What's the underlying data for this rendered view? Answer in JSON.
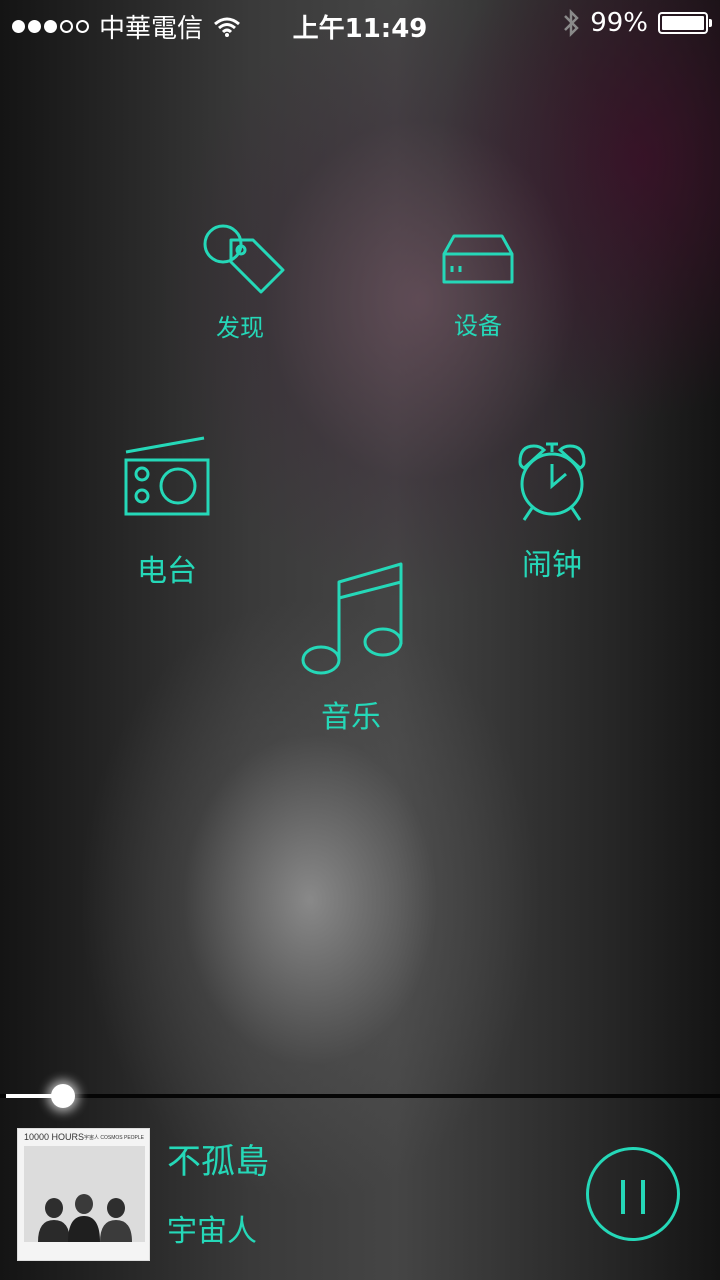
{
  "status_bar": {
    "carrier": "中華電信",
    "time": "上午11:49",
    "battery_percent": "99%",
    "signal_dots_filled": 3,
    "signal_dots_total": 5,
    "icons": [
      "wifi-icon",
      "bluetooth-icon",
      "battery-icon"
    ]
  },
  "menu": {
    "discover": {
      "label": "发现",
      "icon": "tag-icon"
    },
    "devices": {
      "label": "设备",
      "icon": "device-box-icon"
    },
    "radio": {
      "label": "电台",
      "icon": "radio-icon"
    },
    "alarm": {
      "label": "闹钟",
      "icon": "alarm-clock-icon"
    },
    "music": {
      "label": "音乐",
      "icon": "music-note-icon"
    }
  },
  "player": {
    "progress_fraction": 0.08,
    "song_title": "不孤島",
    "artist": "宇宙人",
    "album_cover": {
      "title_text": "10000 HOURS",
      "subtitle_text": "宇宙人 COSMOS PEOPLE"
    },
    "state": "playing",
    "control_icon": "pause-icon"
  },
  "colors": {
    "accent": "#25d8b8",
    "status_text": "#ffffff"
  }
}
